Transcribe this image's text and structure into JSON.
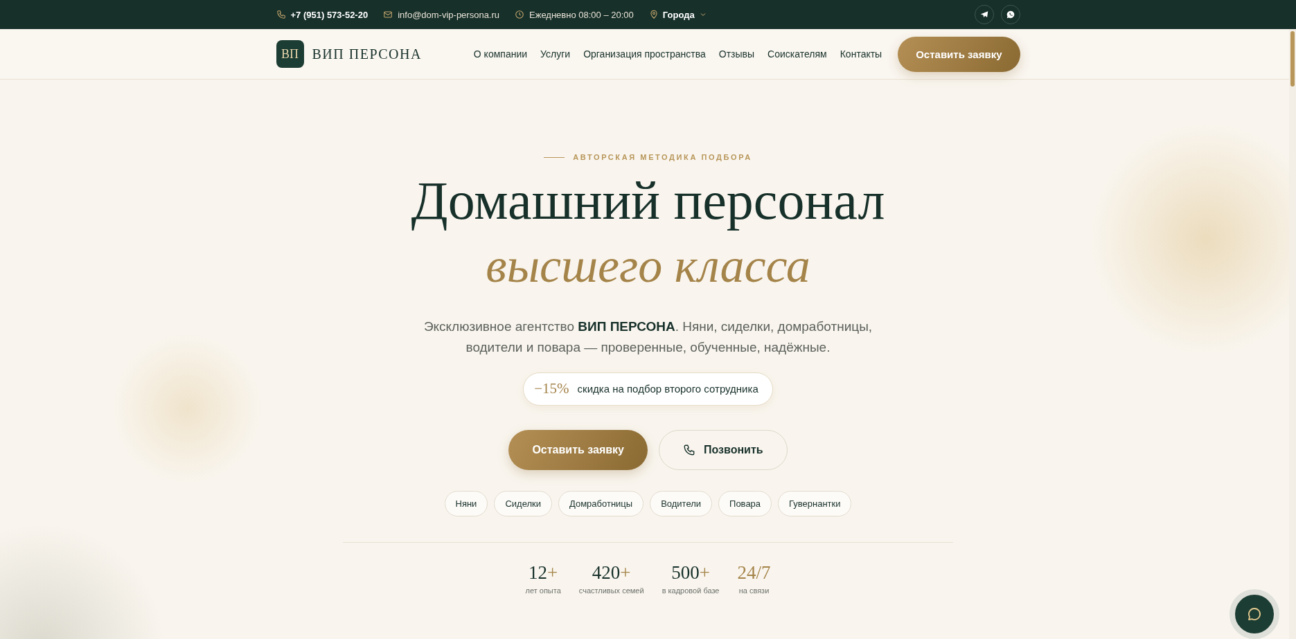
{
  "top_bar": {
    "phone": "+7 (951) 573-52-20",
    "email": "info@dom-vip-persona.ru",
    "hours": "Ежедневно 08:00 – 20:00",
    "city_menu": "Города"
  },
  "header": {
    "logo_mark": "ВП",
    "logo_text": "ВИП ПЕРСОНА",
    "nav": [
      "О компании",
      "Услуги",
      "Организация пространства",
      "Отзывы",
      "Соискателям",
      "Контакты"
    ],
    "cta": "Оставить заявку"
  },
  "hero": {
    "eyebrow": "АВТОРСКАЯ МЕТОДИКА ПОДБОРА",
    "title": "Домашний персонал",
    "title_accent": "высшего класса",
    "lead": "Эксклюзивное агентство **ВИП ПЕРСОНА**. Няни, сиделки, домработницы, водители и повара — проверенные, обученные, надёжные.",
    "promo": {
      "badge": "−15%",
      "text": "скидка на подбор второго сотрудника"
    },
    "buttons": [
      {
        "kind": "primary",
        "label": "Оставить заявку"
      },
      {
        "kind": "phone",
        "label": "Позвонить"
      }
    ],
    "chips": [
      "Няни",
      "Сиделки",
      "Домработницы",
      "Водители",
      "Повара",
      "Гувернантки"
    ],
    "stats": [
      {
        "number": "12",
        "suffix": "+",
        "label": "лет опыта",
        "highlight": false
      },
      {
        "number": "420",
        "suffix": "+",
        "label": "счастливых семей",
        "highlight": false
      },
      {
        "number": "500",
        "suffix": "+",
        "label": "в кадровой базе",
        "highlight": false
      },
      {
        "number": "24/7",
        "label": "на связи",
        "highlight": true
      }
    ]
  }
}
